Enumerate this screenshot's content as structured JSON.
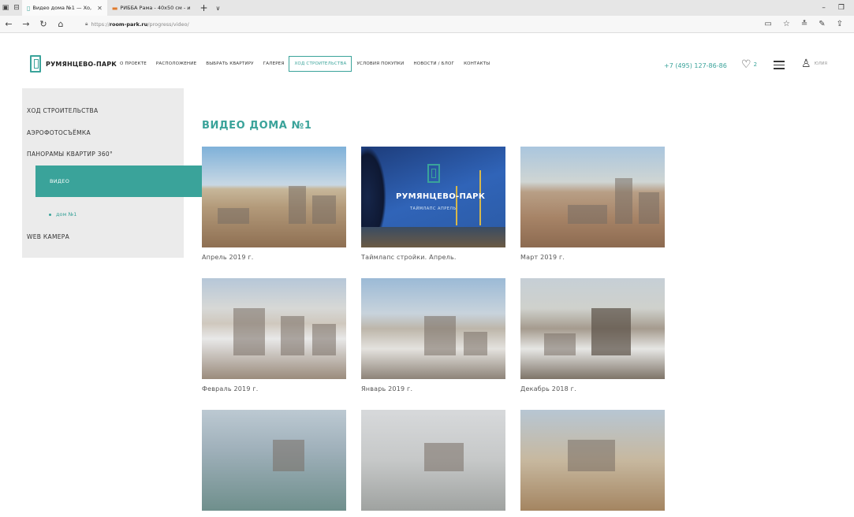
{
  "browser": {
    "tabs": [
      {
        "title": "Видео дома №1 — Хо,",
        "active": true
      },
      {
        "title": "РИББА Рама - 40x50 см - и",
        "active": false
      }
    ],
    "url_prefix": "https://",
    "url_host": "room-park.ru",
    "url_path": "/progress/video/"
  },
  "header": {
    "logo_text": "РУМЯНЦЕВО-ПАРК",
    "nav": [
      {
        "label": "О ПРОЕКТЕ",
        "active": false
      },
      {
        "label": "РАСПОЛОЖЕНИЕ",
        "active": false
      },
      {
        "label": "ВЫБРАТЬ КВАРТИРУ",
        "active": false
      },
      {
        "label": "ГАЛЕРЕЯ",
        "active": false
      },
      {
        "label": "ХОД СТРОИТЕЛЬСТВА",
        "active": true
      },
      {
        "label": "УСЛОВИЯ ПОКУПКИ",
        "active": false
      },
      {
        "label": "НОВОСТИ / БЛОГ",
        "active": false
      },
      {
        "label": "КОНТАКТЫ",
        "active": false
      }
    ],
    "phone": "+7 (495) 127-86-86",
    "favorites_count": "2",
    "user_name": "ЮЛИЯ"
  },
  "sidebar": {
    "items": [
      {
        "label": "ХОД СТРОИТЕЛЬСТВА"
      },
      {
        "label": "АЭРОФОТОСЪЁМКА"
      },
      {
        "label": "ПАНОРАМЫ КВАРТИР 360°"
      },
      {
        "label": "ВИДЕО"
      },
      {
        "label": "WEB КАМЕРА"
      }
    ],
    "sub_item": "дом №1"
  },
  "main": {
    "title": "ВИДЕО ДОМА №1",
    "videos": [
      {
        "caption": "Апрель 2019 г."
      },
      {
        "caption": "Таймлапс стройки. Апрель."
      },
      {
        "caption": "Март 2019 г."
      },
      {
        "caption": "Февраль 2019 г."
      },
      {
        "caption": "Январь 2019 г."
      },
      {
        "caption": "Декабрь 2018 г."
      },
      {
        "caption": ""
      },
      {
        "caption": ""
      },
      {
        "caption": ""
      }
    ],
    "promo_title": "РУМЯНЦЕВО-ПАРК",
    "promo_subtitle": "ТАЙМЛАПС АПРЕЛЬ"
  }
}
